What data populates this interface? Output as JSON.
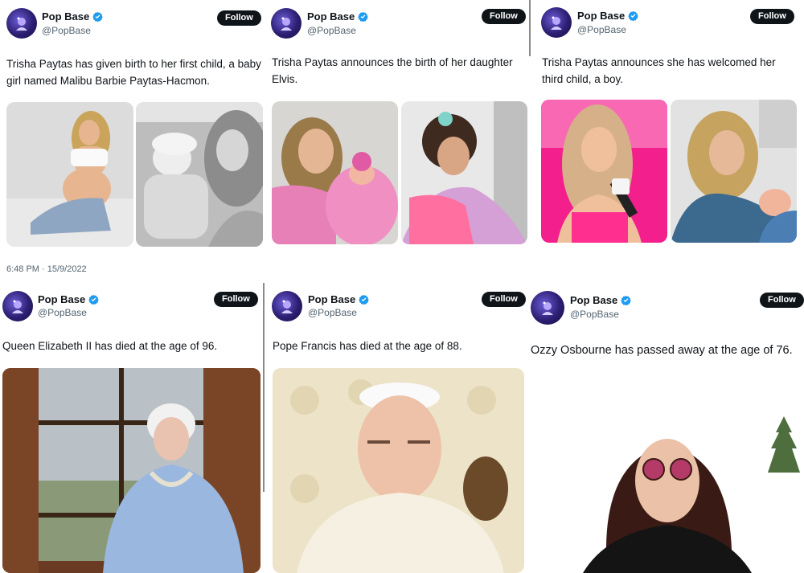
{
  "tweets": [
    {
      "display_name": "Pop Base",
      "handle": "@PopBase",
      "follow_label": "Follow",
      "text": "Trisha Paytas has given birth to her first child, a baby girl named Malibu Barbie Paytas-Hacmon.",
      "timestamp": "6:48 PM · 15/9/2022"
    },
    {
      "display_name": "Pop Base",
      "handle": "@PopBase",
      "follow_label": "Follow",
      "text": "Trisha Paytas announces the birth of her daughter Elvis."
    },
    {
      "display_name": "Pop Base",
      "handle": "@PopBase",
      "follow_label": "Follow",
      "text": "Trisha Paytas announces she has welcomed her third child, a boy."
    },
    {
      "display_name": "Pop Base",
      "handle": "@PopBase",
      "follow_label": "Follow",
      "text": "Queen Elizabeth II has died at the age of 96."
    },
    {
      "display_name": "Pop Base",
      "handle": "@PopBase",
      "follow_label": "Follow",
      "text": "Pope Francis has died at the age of 88."
    },
    {
      "display_name": "Pop Base",
      "handle": "@PopBase",
      "follow_label": "Follow",
      "text": "Ozzy Osbourne has passed away at the age  of 76."
    }
  ],
  "colors": {
    "verified": "#1d9bf0",
    "follow_bg": "#0f1419",
    "text": "#0f1419",
    "muted": "#536471"
  },
  "icons": {
    "verified": "verified-badge-icon",
    "avatar": "pop-base-logo-icon"
  }
}
